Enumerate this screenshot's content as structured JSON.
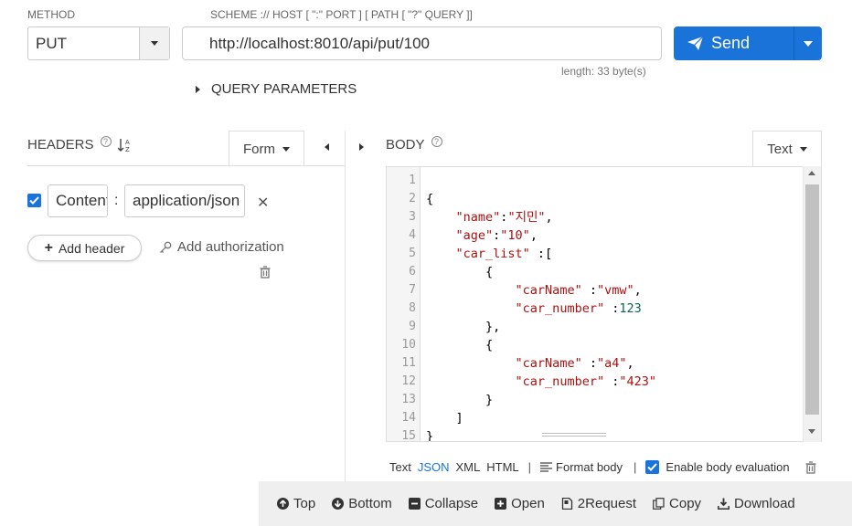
{
  "request": {
    "method_label": "METHOD",
    "method_value": "PUT",
    "url_label": "SCHEME :// HOST [ \":\" PORT ] [ PATH [ \"?\" QUERY ]]",
    "url_value": "http://localhost:8010/api/put/100",
    "length_text": "length: 33 byte(s)",
    "send_label": "Send",
    "query_params_label": "QUERY PARAMETERS"
  },
  "headers": {
    "title": "HEADERS",
    "mode_label": "Form",
    "rows": [
      {
        "enabled": true,
        "name": "Content-Type",
        "separator": ":",
        "value": "application/json"
      }
    ],
    "add_header_label": "Add header",
    "add_auth_label": "Add authorization"
  },
  "body": {
    "title": "BODY",
    "mode_label": "Text",
    "line_numbers": [
      "1",
      "2",
      "3",
      "4",
      "5",
      "6",
      "7",
      "8",
      "9",
      "10",
      "11",
      "12",
      "13",
      "14",
      "15"
    ],
    "footer": {
      "formats": [
        "Text",
        "JSON",
        "XML",
        "HTML"
      ],
      "active_format": "JSON",
      "format_body_label": "Format body",
      "enable_eval_label": "Enable body evaluation",
      "enable_eval_checked": true
    }
  },
  "toolbar": {
    "top": "Top",
    "bottom": "Bottom",
    "collapse": "Collapse",
    "open": "Open",
    "to_request": "2Request",
    "copy": "Copy",
    "download": "Download"
  },
  "colors": {
    "accent": "#1a73d9",
    "json_key": "#aa1111",
    "json_number": "#116644"
  }
}
